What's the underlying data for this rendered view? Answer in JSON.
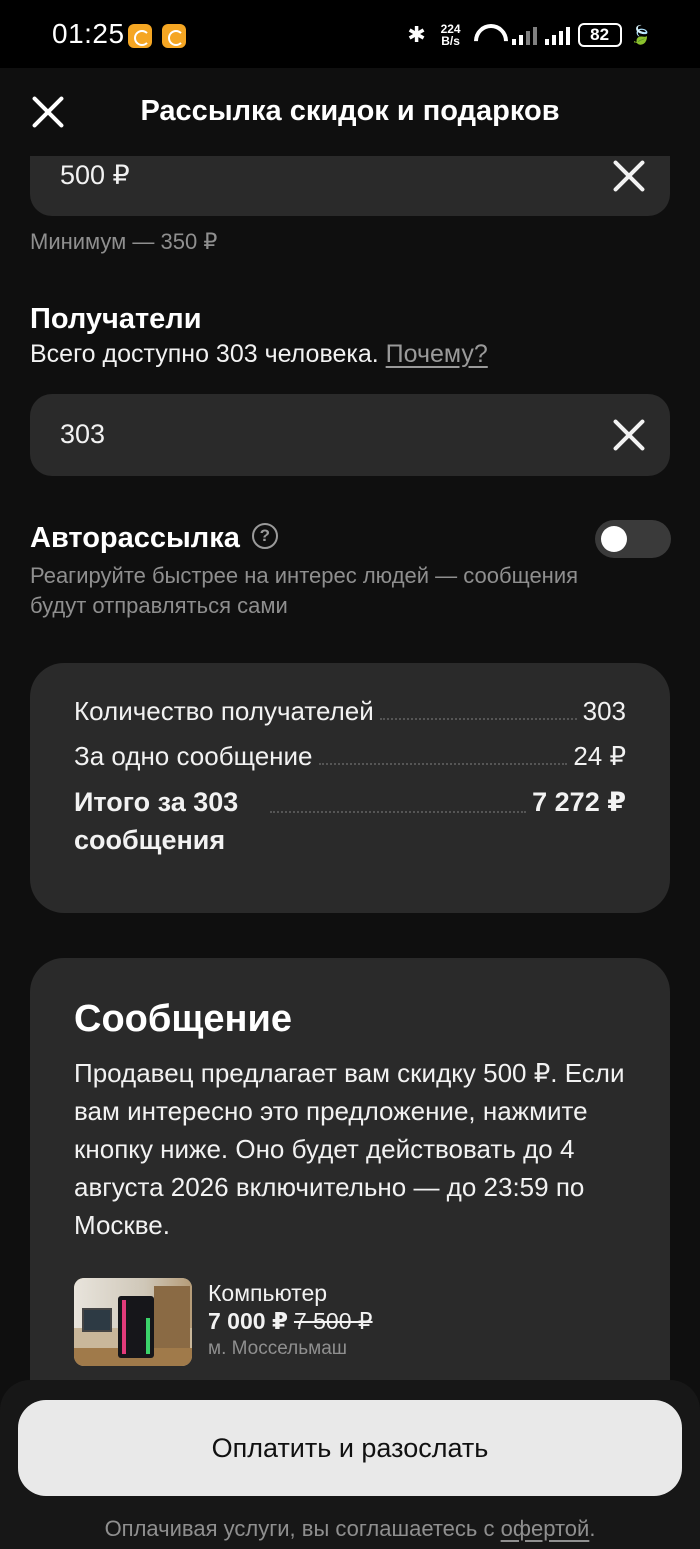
{
  "status_bar": {
    "time": "01:25",
    "speed_value": "224",
    "speed_unit": "B/s",
    "battery": "82",
    "icons": [
      "bluetooth-icon",
      "wifi-icon",
      "signal-icon",
      "battery-icon"
    ]
  },
  "header": {
    "title": "Рассылка скидок и подарков"
  },
  "discount": {
    "value": "500 ₽",
    "hint": "Минимум — 350 ₽"
  },
  "recipients": {
    "title": "Получатели",
    "available_text": "Всего доступно 303 человека.",
    "why_link": "Почему?",
    "value": "303"
  },
  "auto_mailing": {
    "title": "Авторассылка",
    "description": "Реагируйте быстрее на интерес людей — сообщения будут отправляться сами",
    "enabled": false
  },
  "summary": {
    "rows": [
      {
        "label": "Количество получателей",
        "value": "303"
      },
      {
        "label": "За одно сообщение",
        "value": "24 ₽"
      }
    ],
    "total_label": "Итого за 303 сообщения",
    "total_value": "7 272 ₽"
  },
  "message": {
    "title": "Сообщение",
    "body": "Продавец предлагает вам скидку 500 ₽. Если вам интересно это предложение, нажмите кнопку ниже. Оно будет действовать до 4 августа 2026 включительно — до 23:59 по Москве.",
    "product": {
      "name": "Компьютер",
      "price": "7 000 ₽",
      "old_price": "7 500 ₽",
      "metro": "м. Моссельмаш"
    }
  },
  "footer": {
    "pay_button": "Оплатить и разослать",
    "agree_text": "Оплачивая услуги, вы соглашаетесь с",
    "offer_link": "офертой",
    "agree_end": "."
  }
}
